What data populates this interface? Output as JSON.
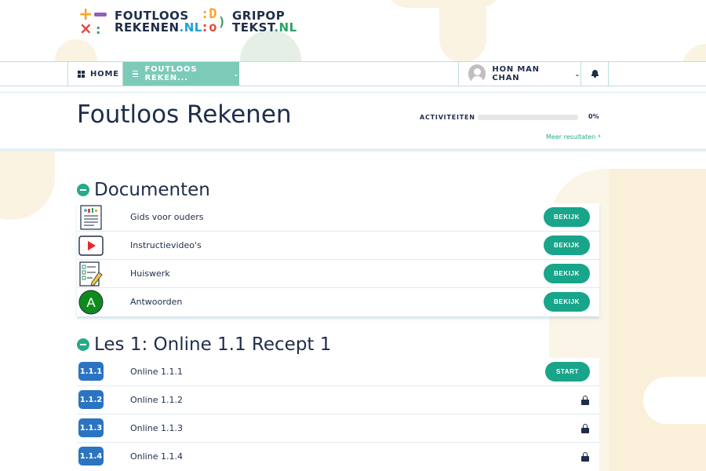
{
  "header": {
    "logo_foutloos": {
      "line1": "FOUTLOOS",
      "line2": "REKENEN",
      "suffix": ".NL"
    },
    "logo_gripop": {
      "line1": "GRIPOP",
      "line2": "TEKST",
      "suffix": ".NL",
      "mark_top": ":D",
      "mark_bottom": ":o",
      "mark_paren": ")"
    }
  },
  "nav": {
    "home_label": "HOME",
    "course_label": "FOUTLOOS REKEN...",
    "user_name": "HON MAN CHAN",
    "accent_color": "#7ccbb8"
  },
  "title_band": {
    "page_title": "Foutloos Rekenen",
    "activities_label": "ACTIVITEITEN",
    "progress_percent": 0,
    "progress_text": "0%",
    "more_results": "Meer resultaten"
  },
  "sections": {
    "documents": {
      "title": "Documenten",
      "items": [
        {
          "label": "Gids voor ouders",
          "button": "BEKIJK",
          "icon": "document-icon"
        },
        {
          "label": "Instructievideo's",
          "button": "BEKIJK",
          "icon": "video-play-icon"
        },
        {
          "label": "Huiswerk",
          "button": "BEKIJK",
          "icon": "checklist-pencil-icon"
        },
        {
          "label": "Antwoorden",
          "button": "BEKIJK",
          "icon": "answers-a-icon",
          "icon_text": "A"
        }
      ]
    },
    "lesson1": {
      "title": "Les 1: Online 1.1 Recept 1",
      "items": [
        {
          "badge": "1.1.1",
          "label": "Online 1.1.1",
          "button": "START",
          "locked": false
        },
        {
          "badge": "1.1.2",
          "label": "Online 1.1.2",
          "locked": true
        },
        {
          "badge": "1.1.3",
          "label": "Online 1.1.3",
          "locked": true
        },
        {
          "badge": "1.1.4",
          "label": "Online 1.1.4",
          "locked": true
        }
      ]
    }
  },
  "colors": {
    "primary_button": "#18a58a",
    "badge_blue": "#2a74c2",
    "text_dark": "#1e2d4a"
  }
}
